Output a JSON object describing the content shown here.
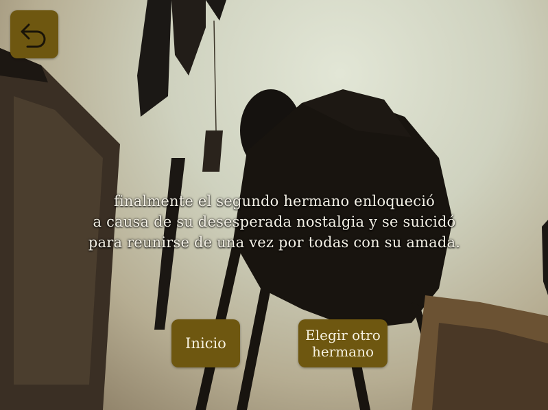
{
  "narration": {
    "lines": [
      "finalmente el segundo hermano enloqueció",
      "a causa de su desesperada nostalgia y se suicidó",
      "para reunirse de una vez por todas con su amada."
    ]
  },
  "buttons": {
    "back_icon": "return-arrow-icon",
    "inicio_label": "Inicio",
    "elegir_lines": [
      "Elegir otro",
      "hermano"
    ]
  },
  "colors": {
    "button_bg": "#6e5710",
    "button_text": "#f6f1e0",
    "narration_text": "#f4f1e6"
  }
}
